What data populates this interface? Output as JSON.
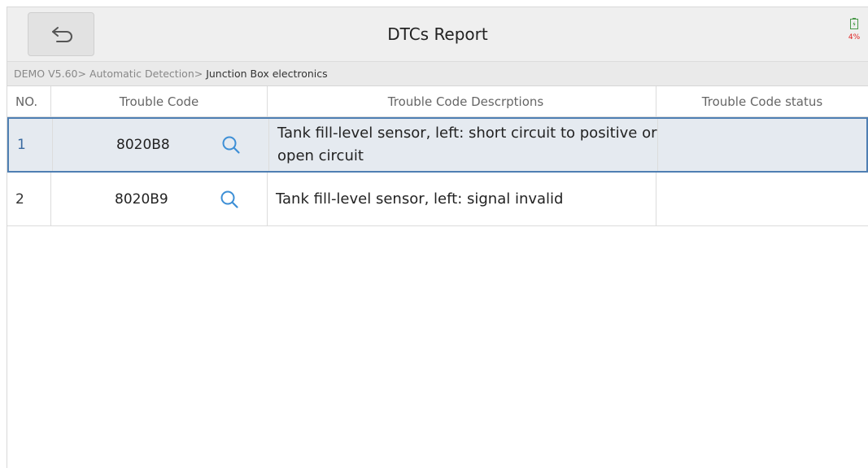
{
  "header": {
    "title": "DTCs Report",
    "battery_pct": "4%"
  },
  "breadcrumb": {
    "path": "DEMO V5.60> Automatic Detection> ",
    "current": "Junction Box electronics"
  },
  "table": {
    "columns": {
      "no": "NO.",
      "code": "Trouble Code",
      "description": "Trouble Code Descrptions",
      "status": "Trouble Code status"
    },
    "rows": [
      {
        "no": "1",
        "code": "8020B8",
        "description": "Tank fill-level sensor, left: short circuit to positive or open circuit",
        "status": ""
      },
      {
        "no": "2",
        "code": "8020B9",
        "description": "Tank fill-level sensor, left: signal invalid",
        "status": ""
      }
    ]
  },
  "colors": {
    "accent": "#4f7fb3",
    "search_icon": "#3d8fd6",
    "selected_row_bg": "#e5eaf0",
    "battery_alert": "#e02020"
  }
}
